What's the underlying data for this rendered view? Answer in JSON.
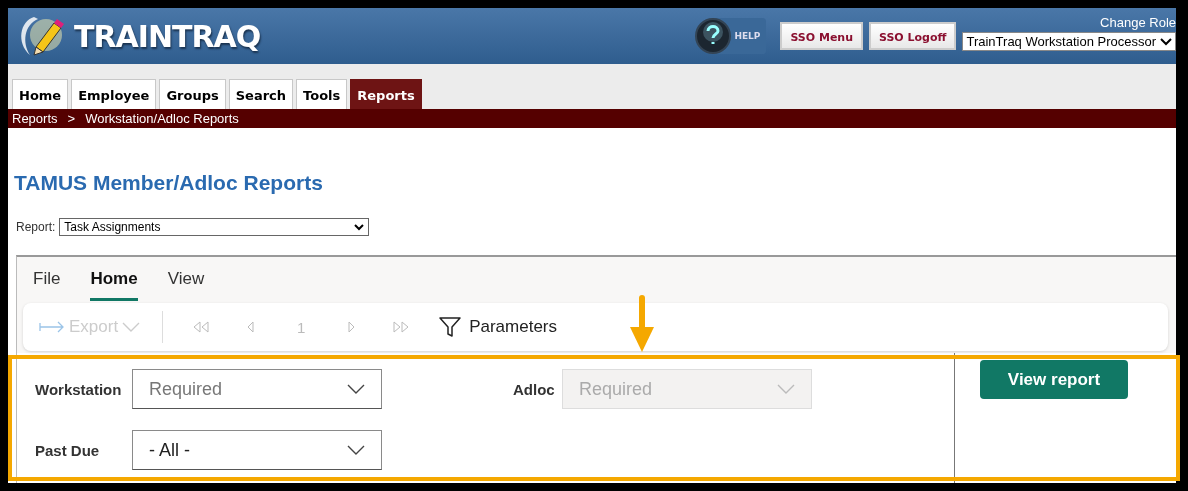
{
  "header": {
    "logo": "TRAINTRAQ",
    "help": "HELP",
    "buttons": [
      "SSO Menu",
      "SSO Logoff"
    ],
    "role_label": "Change Role",
    "role_value": "TrainTraq Workstation Processor"
  },
  "nav_tabs": [
    {
      "label": "Home",
      "selected": false
    },
    {
      "label": "Employee",
      "selected": false
    },
    {
      "label": "Groups",
      "selected": false
    },
    {
      "label": "Search",
      "selected": false
    },
    {
      "label": "Tools",
      "selected": false
    },
    {
      "label": "Reports",
      "selected": true
    }
  ],
  "breadcrumb": {
    "items": [
      "Reports",
      "Workstation/Adloc Reports"
    ],
    "separator": ">"
  },
  "page_title": "TAMUS Member/Adloc Reports",
  "report_select": {
    "label": "Report:",
    "value": "Task Assignments"
  },
  "viewer": {
    "menu": [
      {
        "label": "File",
        "selected": false
      },
      {
        "label": "Home",
        "selected": true
      },
      {
        "label": "View",
        "selected": false
      }
    ],
    "toolbar": {
      "export": {
        "label": "Export",
        "disabled": true
      },
      "nav": [
        {
          "kind": "first",
          "disabled": true
        },
        {
          "kind": "prev",
          "disabled": true
        },
        {
          "kind": "page",
          "label": "1",
          "disabled": true
        },
        {
          "kind": "next",
          "disabled": true
        },
        {
          "kind": "last",
          "disabled": true
        }
      ],
      "parameters": "Parameters"
    },
    "params": [
      {
        "label": "Workstation",
        "placeholder": "Required",
        "disabled": false
      },
      {
        "label": "Adloc",
        "placeholder": "Required",
        "disabled": true
      },
      {
        "label": "Past Due",
        "value": "- All -",
        "disabled": false
      }
    ],
    "submit": "View report"
  }
}
